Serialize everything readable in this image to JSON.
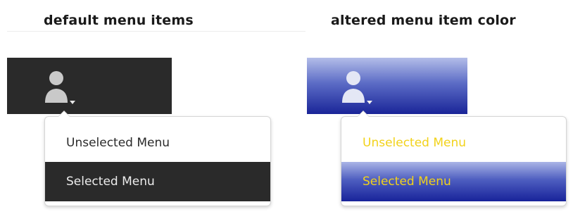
{
  "headings": {
    "left": "default menu items",
    "right": "altered menu item color"
  },
  "left_panel": {
    "icon": "user-icon",
    "menu": {
      "unselected_label": "Unselected Menu",
      "selected_label": "Selected Menu"
    },
    "colors": {
      "bar": "#2a2a2a",
      "unselected_text": "#2a2a2a",
      "selected_bg": "#2a2a2a",
      "selected_text": "#ececec"
    }
  },
  "right_panel": {
    "icon": "user-icon",
    "menu": {
      "unselected_label": "Unselected Menu",
      "selected_label": "Selected Menu"
    },
    "colors": {
      "bar_top": "#b3bde8",
      "bar_bottom": "#1a2598",
      "unselected_text": "#f2d21a",
      "selected_text": "#f2d21a"
    }
  }
}
